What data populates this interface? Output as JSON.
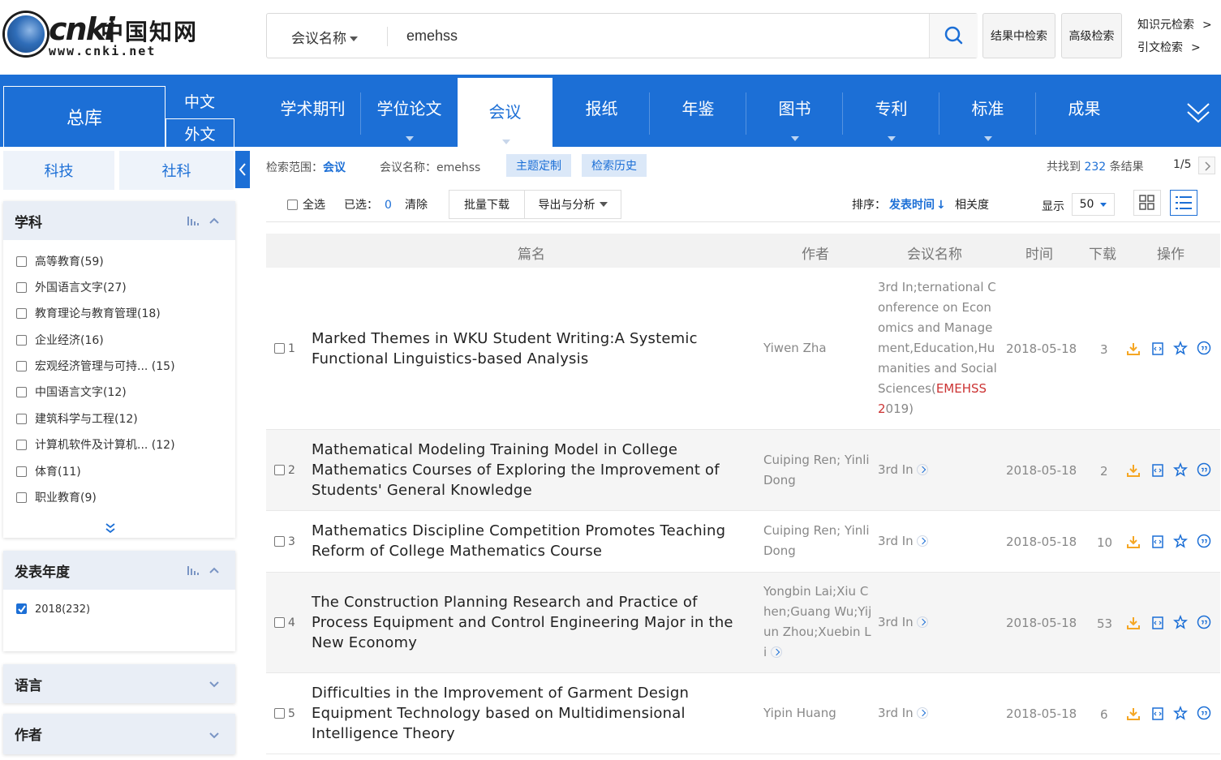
{
  "header": {
    "logo_mark": "cnki",
    "logo_cn": "中国知网",
    "logo_url": "www.cnki.net",
    "search_type": "会议名称",
    "search_value": "emehss",
    "btn_in_results": "结果中检索",
    "btn_advanced": "高级检索",
    "link_knowledge": "知识元检索",
    "link_citation": "引文检索",
    "arrow": ">"
  },
  "nav": {
    "main": "总库",
    "lang_cn": "中文",
    "lang_en": "外文",
    "tabs": [
      "学术期刊",
      "学位论文",
      "会议",
      "报纸",
      "年鉴",
      "图书",
      "专利",
      "标准",
      "成果"
    ],
    "active_tab": "会议"
  },
  "sidebar": {
    "subtab_sci": "科技",
    "subtab_soc": "社科",
    "subject": {
      "title": "学科",
      "items": [
        {
          "label": "高等教育(59)"
        },
        {
          "label": "外国语言文字(27)"
        },
        {
          "label": "教育理论与教育管理(18)"
        },
        {
          "label": "企业经济(16)"
        },
        {
          "label": "宏观经济管理与可持... (15)"
        },
        {
          "label": "中国语言文字(12)"
        },
        {
          "label": "建筑科学与工程(12)"
        },
        {
          "label": "计算机软件及计算机... (12)"
        },
        {
          "label": "体育(11)"
        },
        {
          "label": "职业教育(9)"
        }
      ]
    },
    "year": {
      "title": "发表年度",
      "items": [
        {
          "label": "2018(232)",
          "checked": true
        }
      ]
    },
    "language": {
      "title": "语言"
    },
    "author": {
      "title": "作者"
    }
  },
  "toolbar": {
    "scope_label": "检索范围：",
    "scope_value": "会议",
    "conf_label": "会议名称：emehss",
    "tag_topic": "主题定制",
    "tag_history": "检索历史",
    "found_prefix": "共找到",
    "found_count": "232",
    "found_suffix": "条结果",
    "page": "1/5",
    "select_all": "全选",
    "selected_label": "已选：",
    "selected_count": "0",
    "clear": "清除",
    "batch_download": "批量下载",
    "export": "导出与分析",
    "sort_label": "排序：",
    "sort_time": "发表时间",
    "sort_relevance": "相关度",
    "display_label": "显示",
    "display_count": "50"
  },
  "table": {
    "headers": {
      "title": "篇名",
      "author": "作者",
      "conf": "会议名称",
      "date": "时间",
      "downloads": "下载",
      "ops": "操作"
    },
    "rows": [
      {
        "num": "1",
        "title": "Marked Themes in WKU Student Writing:A Systemic Functional Linguistics-based Analysis",
        "author": "Yiwen Zha",
        "conf": "3rd In;ternational Conference on Economics and Management,Education,Humanities and Social Sciences(",
        "conf_hl": "EMEHSS 2",
        "conf_tail": "019)",
        "date": "2018-05-18",
        "downloads": "3"
      },
      {
        "num": "2",
        "title": "Mathematical Modeling Training Model in College Mathematics Courses of Exploring the Improvement of Students' General Knowledge",
        "author": "Cuiping Ren; Yinli Dong",
        "conf": "3rd In",
        "date": "2018-05-18",
        "downloads": "2"
      },
      {
        "num": "3",
        "title": "Mathematics Discipline Competition Promotes Teaching Reform of College Mathematics Course",
        "author": "Cuiping Ren; Yinli Dong",
        "conf": "3rd In",
        "date": "2018-05-18",
        "downloads": "10"
      },
      {
        "num": "4",
        "title": "The Construction Planning Research and Practice of Process Equipment and Control Engineering Major in the New Economy",
        "author": "Yongbin Lai;Xiu Chen;Guang Wu;Yijun Zhou;Xuebin Li",
        "conf": "3rd In",
        "date": "2018-05-18",
        "downloads": "53"
      },
      {
        "num": "5",
        "title": "Difficulties in the Improvement of Garment Design Equipment Technology based on Multidimensional Intelligence Theory",
        "author": "Yipin Huang",
        "conf": "3rd In",
        "date": "2018-05-18",
        "downloads": "6"
      }
    ]
  },
  "colors": {
    "brand": "#1c6fd6",
    "highlight": "#c33333",
    "download": "#f5a623"
  }
}
